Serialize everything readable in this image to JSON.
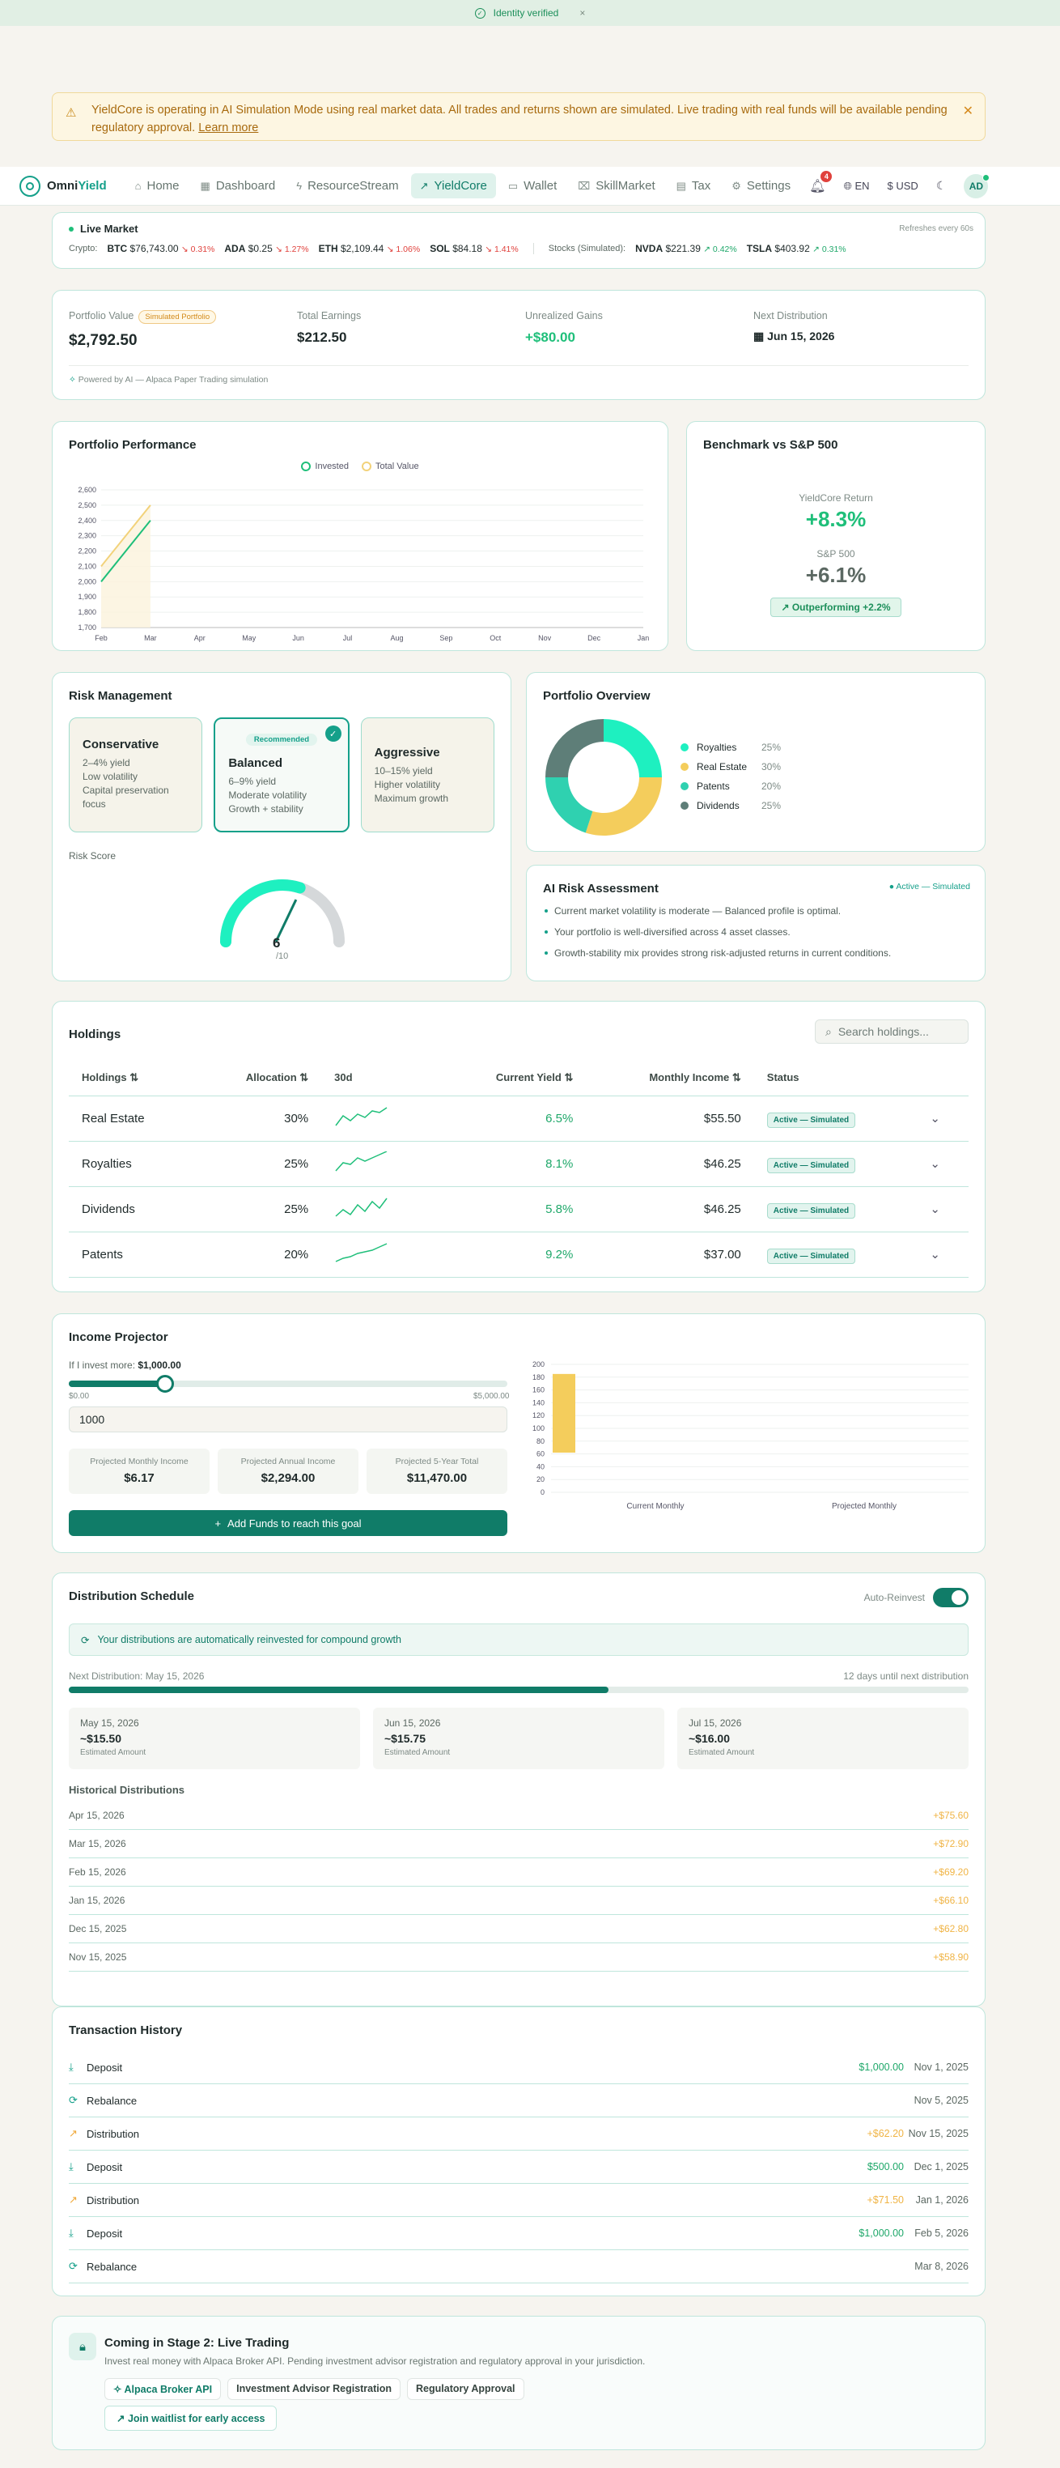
{
  "banner": {
    "verified": "Identity verified",
    "close": "×"
  },
  "warning": {
    "text": "YieldCore is operating in AI Simulation Mode using real market data. All trades and returns shown are simulated. Live trading with real funds will be available pending regulatory approval.",
    "link": "Learn more"
  },
  "nav": {
    "brand_a": "Omni",
    "brand_b": "Yield",
    "items": [
      {
        "label": "Home",
        "icon": "home-icon",
        "glyph": "⌂"
      },
      {
        "label": "Dashboard",
        "icon": "dashboard-icon",
        "glyph": "▦"
      },
      {
        "label": "ResourceStream",
        "icon": "bolt-icon",
        "glyph": "ϟ"
      },
      {
        "label": "YieldCore",
        "icon": "trend-icon",
        "glyph": "↗"
      },
      {
        "label": "Wallet",
        "icon": "wallet-icon",
        "glyph": "▭"
      },
      {
        "label": "SkillMarket",
        "icon": "store-icon",
        "glyph": "⌧"
      },
      {
        "label": "Tax",
        "icon": "receipt-icon",
        "glyph": "▤"
      },
      {
        "label": "Settings",
        "icon": "gear-icon",
        "glyph": "⚙"
      }
    ],
    "notifications": "4",
    "lang": "EN",
    "currency": "USD",
    "avatar": "AD"
  },
  "ticker": {
    "title": "Live Market",
    "refresh": "Refreshes every 60s",
    "crypto_label": "Crypto:",
    "crypto": [
      {
        "sym": "BTC",
        "price": "$76,743.00",
        "chg": "↘ 0.31%",
        "dir": "dn"
      },
      {
        "sym": "ADA",
        "price": "$0.25",
        "chg": "↘ 1.27%",
        "dir": "dn"
      },
      {
        "sym": "ETH",
        "price": "$2,109.44",
        "chg": "↘ 1.06%",
        "dir": "dn"
      },
      {
        "sym": "SOL",
        "price": "$84.18",
        "chg": "↘ 1.41%",
        "dir": "dn"
      }
    ],
    "stocks_label": "Stocks (Simulated):",
    "stocks": [
      {
        "sym": "NVDA",
        "price": "$221.39",
        "chg": "↗ 0.42%",
        "dir": "up"
      },
      {
        "sym": "TSLA",
        "price": "$403.92",
        "chg": "↗ 0.31%",
        "dir": "up"
      }
    ]
  },
  "summary": {
    "portfolio_label": "Portfolio Value",
    "portfolio_badge": "Simulated Portfolio",
    "portfolio_value": "$2,792.50",
    "earnings_label": "Total Earnings",
    "earnings_value": "$212.50",
    "unrealized_label": "Unrealized Gains",
    "unrealized_value": "+$80.00",
    "next_label": "Next Distribution",
    "next_value": "Jun 15, 2026",
    "powered": "Powered by AI — Alpaca Paper Trading simulation"
  },
  "performance": {
    "title": "Portfolio Performance"
  },
  "chart_data": {
    "type": "line",
    "title": "Portfolio Performance",
    "categories": [
      "Feb",
      "Mar",
      "Apr",
      "May",
      "Jun",
      "Jul",
      "Aug",
      "Sep",
      "Oct",
      "Nov",
      "Dec",
      "Jan"
    ],
    "yticks": [
      1700,
      1800,
      1900,
      2000,
      2100,
      2200,
      2300,
      2400,
      2500,
      2600
    ],
    "ylim": [
      1700,
      2600
    ],
    "series": [
      {
        "name": "Invested",
        "color": "#1fbf7a",
        "values": [
          2000,
          2400
        ]
      },
      {
        "name": "Total Value",
        "color": "#f2d27a",
        "values": [
          2100,
          2500
        ]
      }
    ]
  },
  "benchmark": {
    "title": "Benchmark vs S&P 500",
    "yc_label": "YieldCore Return",
    "yc_value": "+8.3%",
    "sp_label": "S&P 500",
    "sp_value": "+6.1%",
    "badge": "Outperforming +2.2%"
  },
  "risk": {
    "title": "Risk Management",
    "recommended": "Recommended",
    "cards": [
      {
        "name": "Conservative",
        "l1": "2–4% yield",
        "l2": "Low volatility",
        "l3": "Capital preservation focus"
      },
      {
        "name": "Balanced",
        "l1": "6–9% yield",
        "l2": "Moderate volatility",
        "l3": "Growth + stability"
      },
      {
        "name": "Aggressive",
        "l1": "10–15% yield",
        "l2": "Higher volatility",
        "l3": "Maximum growth"
      }
    ],
    "score_label": "Risk Score",
    "score_value": "6",
    "score_max": "/10",
    "score_fraction": 0.6
  },
  "overview": {
    "title": "Portfolio Overview",
    "slices": [
      {
        "name": "Royalties",
        "pct": "25%",
        "value": 25,
        "color": "#1ef0c0"
      },
      {
        "name": "Real Estate",
        "pct": "30%",
        "value": 30,
        "color": "#f4cd5c"
      },
      {
        "name": "Patents",
        "pct": "20%",
        "value": 20,
        "color": "#2fd1b0"
      },
      {
        "name": "Dividends",
        "pct": "25%",
        "value": 25,
        "color": "#5e7e78"
      }
    ]
  },
  "ai": {
    "title": "AI Risk Assessment",
    "status": "● Active — Simulated",
    "items": [
      "Current market volatility is moderate — Balanced profile is optimal.",
      "Your portfolio is well-diversified across 4 asset classes.",
      "Growth-stability mix provides strong risk-adjusted returns in current conditions."
    ]
  },
  "holdings": {
    "title": "Holdings",
    "search_placeholder": "Search holdings...",
    "headers": [
      "Holdings ⇅",
      "Allocation ⇅",
      "30d",
      "Current Yield ⇅",
      "Monthly Income ⇅",
      "Status"
    ],
    "rows": [
      {
        "name": "Real Estate",
        "alloc": "30%",
        "yield": "6.5%",
        "income": "$55.50",
        "status": "Active — Simulated"
      },
      {
        "name": "Royalties",
        "alloc": "25%",
        "yield": "8.1%",
        "income": "$46.25",
        "status": "Active — Simulated"
      },
      {
        "name": "Dividends",
        "alloc": "25%",
        "yield": "5.8%",
        "income": "$46.25",
        "status": "Active — Simulated"
      },
      {
        "name": "Patents",
        "alloc": "20%",
        "yield": "9.2%",
        "income": "$37.00",
        "status": "Active — Simulated"
      }
    ]
  },
  "income": {
    "title": "Income Projector",
    "invest_prefix": "If I invest more:",
    "invest_value": "$1,000.00",
    "min": "$0.00",
    "max": "$5,000.00",
    "input_value": "1000",
    "monthly_label": "Projected Monthly Income",
    "monthly_value": "$6.17",
    "annual_label": "Projected Annual Income",
    "annual_value": "$2,294.00",
    "five_label": "Projected 5-Year Total",
    "five_value": "$11,470.00",
    "button": "Add Funds to reach this goal",
    "chart_categories": [
      "Current Monthly",
      "Projected Monthly"
    ],
    "chart_yticks": [
      0,
      20,
      40,
      60,
      80,
      100,
      120,
      140,
      160,
      180,
      200
    ],
    "chart_bar_range": [
      62,
      185
    ]
  },
  "distribution": {
    "title": "Distribution Schedule",
    "auto_label": "Auto-Reinvest",
    "reinvest": "Your distributions are automatically reinvested for compound growth",
    "next": "Next Distribution: May 15, 2026",
    "days": "12 days until next distribution",
    "progress": 0.6,
    "upcoming": [
      {
        "date": "May 15, 2026",
        "amt": "~$15.50",
        "est": "Estimated Amount"
      },
      {
        "date": "Jun 15, 2026",
        "amt": "~$15.75",
        "est": "Estimated Amount"
      },
      {
        "date": "Jul 15, 2026",
        "amt": "~$16.00",
        "est": "Estimated Amount"
      }
    ],
    "hist_title": "Historical Distributions",
    "history": [
      {
        "date": "Apr 15, 2026",
        "amt": "+$75.60"
      },
      {
        "date": "Mar 15, 2026",
        "amt": "+$72.90"
      },
      {
        "date": "Feb 15, 2026",
        "amt": "+$69.20"
      },
      {
        "date": "Jan 15, 2026",
        "amt": "+$66.10"
      },
      {
        "date": "Dec 15, 2025",
        "amt": "+$62.80"
      },
      {
        "date": "Nov 15, 2025",
        "amt": "+$58.90"
      }
    ]
  },
  "transactions": {
    "title": "Transaction History",
    "rows": [
      {
        "icon": "download-icon",
        "glyph": "⤓",
        "type": "Deposit",
        "amt": "$1,000.00",
        "cls": "g",
        "date": "Nov 1, 2025"
      },
      {
        "icon": "rebalance-icon",
        "glyph": "⟳",
        "type": "Rebalance",
        "amt": "",
        "cls": "",
        "date": "Nov 5, 2025"
      },
      {
        "icon": "trend-icon",
        "glyph": "↗",
        "type": "Distribution",
        "amt": "+$62.20",
        "cls": "o",
        "date": "Nov 15, 2025"
      },
      {
        "icon": "download-icon",
        "glyph": "⤓",
        "type": "Deposit",
        "amt": "$500.00",
        "cls": "g",
        "date": "Dec 1, 2025"
      },
      {
        "icon": "trend-icon",
        "glyph": "↗",
        "type": "Distribution",
        "amt": "+$71.50",
        "cls": "o",
        "date": "Jan 1, 2026"
      },
      {
        "icon": "download-icon",
        "glyph": "⤓",
        "type": "Deposit",
        "amt": "$1,000.00",
        "cls": "g",
        "date": "Feb 5, 2026"
      },
      {
        "icon": "rebalance-icon",
        "glyph": "⟳",
        "type": "Rebalance",
        "amt": "",
        "cls": "",
        "date": "Mar 8, 2026"
      }
    ]
  },
  "stage": {
    "title": "Coming in Stage 2: Live Trading",
    "sub": "Invest real money with Alpaca Broker API. Pending investment advisor registration and regulatory approval in your jurisdiction.",
    "tags": [
      "Alpaca Broker API",
      "Investment Advisor Registration",
      "Regulatory Approval"
    ],
    "waitlist": "Join waitlist for early access"
  }
}
